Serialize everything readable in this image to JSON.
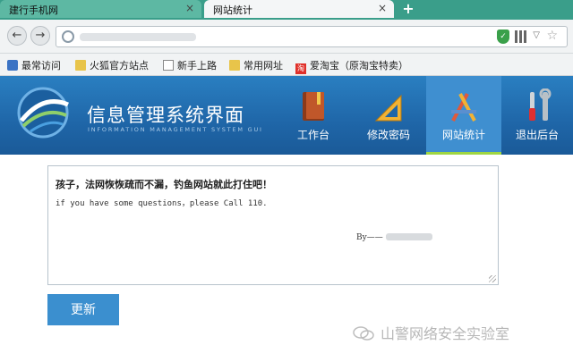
{
  "tabs": [
    {
      "label": "建行手机网",
      "close": "×"
    },
    {
      "label": "网站统计",
      "close": "×"
    }
  ],
  "new_tab_label": "+",
  "nav": {
    "back_label": "←",
    "forward_label": "→",
    "dropdown_label": "▽",
    "star_label": "☆",
    "shield_label": "✓"
  },
  "bookmarks": [
    {
      "label": "最常访问",
      "icon": "gear-icon"
    },
    {
      "label": "火狐官方站点",
      "icon": "folder-icon"
    },
    {
      "label": "新手上路",
      "icon": "page-icon"
    },
    {
      "label": "常用网址",
      "icon": "folder-icon"
    },
    {
      "label": "爱淘宝（原淘宝特卖）",
      "icon": "taobao-icon",
      "icon_text": "淘"
    }
  ],
  "app": {
    "title": "信息管理系统界面",
    "subtitle": "INFORMATION MANAGEMENT SYSTEM GUI",
    "nav_items": [
      {
        "label": "工作台",
        "icon": "book-icon",
        "active": false
      },
      {
        "label": "修改密码",
        "icon": "ruler-triangle-icon",
        "active": false
      },
      {
        "label": "网站统计",
        "icon": "tools-icon",
        "active": true
      },
      {
        "label": "退出后台",
        "icon": "wrench-screwdriver-icon",
        "active": false
      }
    ],
    "active_color": "#3f8fd0",
    "accent_color": "#9fd642"
  },
  "content": {
    "line1": "孩子，法网恢恢疏而不漏，钓鱼网站就此打住吧！",
    "line2": "if you have some questions，please Call 110.",
    "signature_prefix": "By——"
  },
  "update_button": "更新",
  "watermark": "山警网络安全实验室"
}
